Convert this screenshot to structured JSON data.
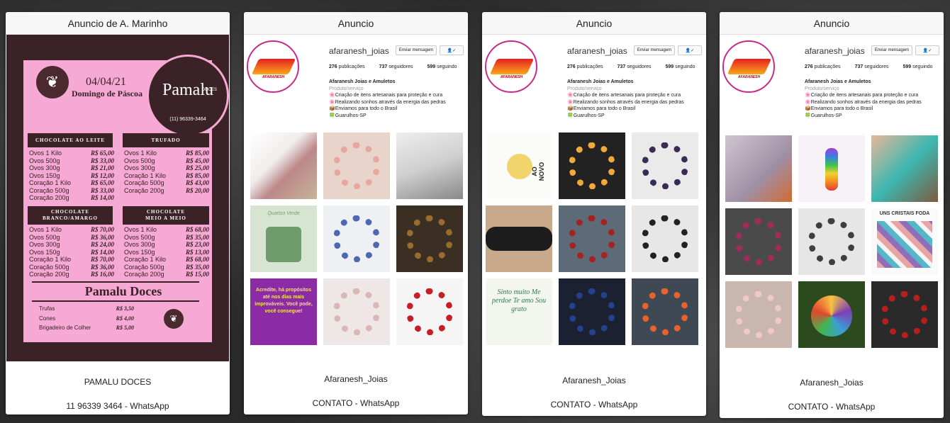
{
  "cards": [
    {
      "header": "Anuncio de A. Marinho",
      "footer_line1": "PAMALU DOCES",
      "footer_line2": "11 96339 3464 - WhatsApp",
      "menu": {
        "date": "04/04/21",
        "day": "Domingo de Páscoa",
        "brand": "Pamalu",
        "brand_sub": "DOCES",
        "phone": "(11) 96339-3464",
        "sections": [
          {
            "title": "CHOCOLATE AO LEITE",
            "items": [
              {
                "name": "Ovos 1 Kilo",
                "price": "R$ 65,00"
              },
              {
                "name": "Ovos 500g",
                "price": "R$ 33,00"
              },
              {
                "name": "Ovos 300g",
                "price": "R$ 21,00"
              },
              {
                "name": "Ovos 150g",
                "price": "R$ 12,00"
              },
              {
                "name": "Coração 1 Kilo",
                "price": "R$ 65,00"
              },
              {
                "name": "Coração 500g",
                "price": "R$ 33,00"
              },
              {
                "name": "Coração 200g",
                "price": "R$ 14,00"
              }
            ]
          },
          {
            "title": "TRUFADO",
            "items": [
              {
                "name": "Ovos 1 Kilo",
                "price": "R$ 85,00"
              },
              {
                "name": "Ovos 500g",
                "price": "R$ 45,00"
              },
              {
                "name": "Ovos 300g",
                "price": "R$ 25,00"
              },
              {
                "name": "Coração 1 Kilo",
                "price": "R$ 85,00"
              },
              {
                "name": "Coração 500g",
                "price": "R$ 43,00"
              },
              {
                "name": "Coração 200g",
                "price": "R$ 20,00"
              }
            ]
          },
          {
            "title": "CHOCOLATE BRANCO/AMARGO",
            "items": [
              {
                "name": "Ovos 1 Kilo",
                "price": "R$ 70,00"
              },
              {
                "name": "Ovos 500g",
                "price": "R$ 36,00"
              },
              {
                "name": "Ovos 300g",
                "price": "R$ 24,00"
              },
              {
                "name": "Ovos 150g",
                "price": "R$ 14,00"
              },
              {
                "name": "Coração 1 Kilo",
                "price": "R$ 70,00"
              },
              {
                "name": "Coração 500g",
                "price": "R$ 36,00"
              },
              {
                "name": "Coração 200g",
                "price": "R$ 16,00"
              }
            ]
          },
          {
            "title": "CHOCOLATE MEIO A MEIO",
            "items": [
              {
                "name": "Ovos 1 Kilo",
                "price": "R$ 68,00"
              },
              {
                "name": "Ovos 500g",
                "price": "R$ 35,00"
              },
              {
                "name": "Ovos 300g",
                "price": "R$ 23,00"
              },
              {
                "name": "Ovos 150g",
                "price": "R$ 13,00"
              },
              {
                "name": "Coração 1 Kilo",
                "price": "R$ 68,00"
              },
              {
                "name": "Coração 500g",
                "price": "R$ 35,00"
              },
              {
                "name": "Coração 200g",
                "price": "R$ 15,00"
              }
            ]
          }
        ],
        "footer_title": "Pamalu Doces",
        "extras": [
          {
            "name": "Trufas",
            "price": "R$ 3,50"
          },
          {
            "name": "Cones",
            "price": "R$ 4,00"
          },
          {
            "name": "Brigadeiro de Colher",
            "price": "R$ 5,00"
          }
        ]
      }
    },
    {
      "header": "Anuncio",
      "footer_line1": "Afaranesh_Joias",
      "footer_line2": "CONTATO - WhatsApp"
    },
    {
      "header": "Anuncio",
      "footer_line1": "Afaranesh_Joias",
      "footer_line2": "CONTATO - WhatsApp"
    },
    {
      "header": "Anuncio",
      "footer_line1": "Afaranesh_Joias",
      "footer_line2": "CONTATO - WhatsApp"
    }
  ],
  "instagram": {
    "username": "afaranesh_joias",
    "message_button": "Enviar mensagem",
    "follow_icon": "person-check-icon",
    "posts": "276",
    "posts_label": "publicações",
    "followers": "737",
    "followers_label": "seguidores",
    "following": "599",
    "following_label": "seguindo",
    "bio_name": "Afaranesh Joias e Amuletos",
    "bio_category": "Produto/serviço",
    "bio_lines": [
      "🌸Criação de itens artesanais para proteção e cura",
      "🌸Realizando sonhos através da energia das pedras",
      "📦Enviamos para todo o Brasil",
      "🍀Guarulhos-SP"
    ],
    "logo_word": "AFARANESH"
  },
  "tile_captions": {
    "quartzo": "Quartzo Verde",
    "acredite": "Acredite, há propósitos até nos dias mais improváveis. Você pode, você consegue!",
    "ao_novo": "AO NOVO",
    "sinto_muito": "Sinto muito Me perdoe Te amo Sou grato",
    "cristais": "UNS CRISTAIS FODA"
  },
  "colors": {
    "menu_brown": "#3b2226",
    "menu_pink": "#f5a9d4",
    "ig_ring": "#c72b8a"
  }
}
